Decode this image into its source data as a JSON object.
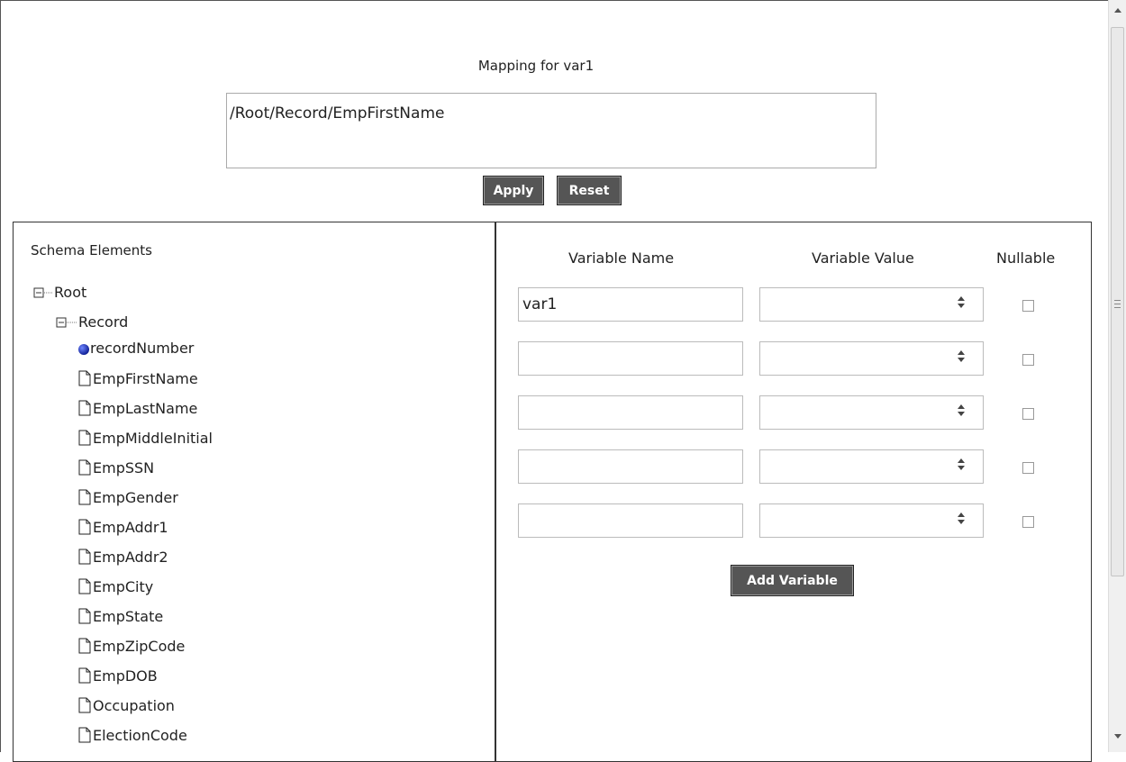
{
  "mapping": {
    "title": "Mapping for var1",
    "expression": "/Root/Record/EmpFirstName"
  },
  "buttons": {
    "apply": "Apply",
    "reset": "Reset",
    "add_variable": "Add Variable"
  },
  "schema": {
    "title": "Schema Elements",
    "root": "Root",
    "record": "Record",
    "attribute": "recordNumber",
    "elements": [
      "EmpFirstName",
      "EmpLastName",
      "EmpMiddleInitial",
      "EmpSSN",
      "EmpGender",
      "EmpAddr1",
      "EmpAddr2",
      "EmpCity",
      "EmpState",
      "EmpZipCode",
      "EmpDOB",
      "Occupation",
      "ElectionCode"
    ]
  },
  "variables": {
    "headers": {
      "name": "Variable Name",
      "value": "Variable Value",
      "nullable": "Nullable"
    },
    "rows": [
      {
        "name": "var1",
        "value": "",
        "nullable": false
      },
      {
        "name": "",
        "value": "",
        "nullable": false
      },
      {
        "name": "",
        "value": "",
        "nullable": false
      },
      {
        "name": "",
        "value": "",
        "nullable": false
      },
      {
        "name": "",
        "value": "",
        "nullable": false
      }
    ]
  },
  "colors": {
    "button_bg": "#555555",
    "button_text": "#ffffff",
    "attribute_icon": "#1a2fb5"
  },
  "icons": {
    "collapse": "minus-box-icon",
    "element": "document-icon",
    "attribute": "blue-ball-icon"
  }
}
